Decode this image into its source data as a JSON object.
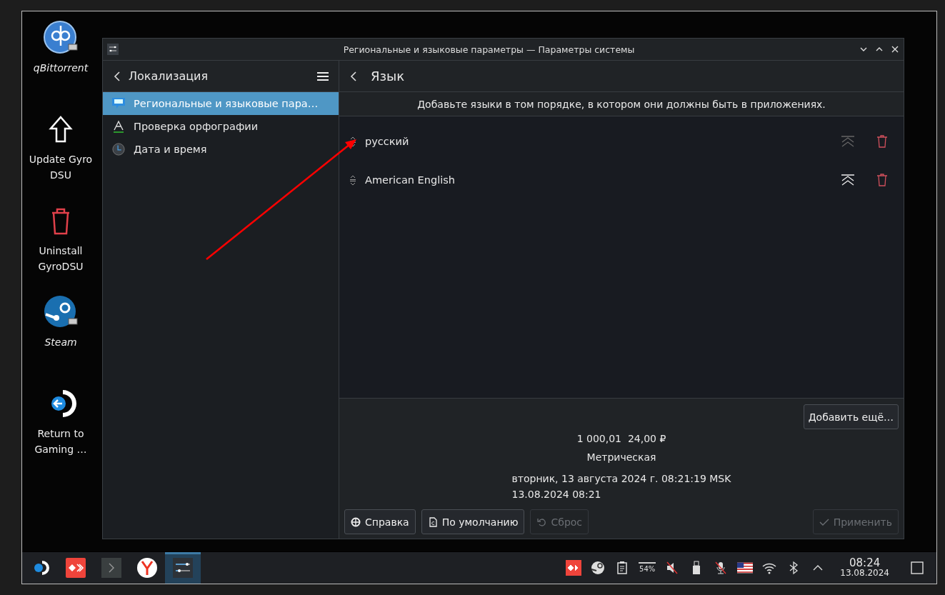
{
  "desktop_icons": [
    {
      "kind": "qbittorrent",
      "label": "qBittorrent",
      "link": true
    },
    {
      "kind": "update",
      "label": "Update Gyro DSU",
      "link": false
    },
    {
      "kind": "uninstall",
      "label": "Uninstall GyroDSU",
      "link": false
    },
    {
      "kind": "steam",
      "label": "Steam",
      "link": true
    },
    {
      "kind": "return",
      "label": "Return to Gaming …",
      "link": false
    }
  ],
  "window": {
    "title": "Региональные и языковые параметры — Параметры системы"
  },
  "sidebar": {
    "title": "Локализация",
    "items": [
      {
        "kind": "region",
        "label": "Региональные и языковые пара…",
        "selected": true
      },
      {
        "kind": "spelling",
        "label": "Проверка орфографии",
        "selected": false
      },
      {
        "kind": "clock",
        "label": "Дата и время",
        "selected": false
      }
    ]
  },
  "page": {
    "title": "Язык",
    "hint": "Добавьте языки в том порядке, в котором они должны быть в приложениях.",
    "languages": [
      {
        "name": "русский",
        "move_top_disabled": true
      },
      {
        "name": "American English",
        "move_top_disabled": false
      }
    ],
    "add_button": "Добавить ещё…",
    "preview": {
      "numbers": "1 000,01  24,00 ₽",
      "measurement": "Метрическая",
      "datetime_long": "вторник, 13 августа 2024 г. 08:21:19 MSK",
      "datetime_short": "13.08.2024 08:21"
    },
    "buttons": [
      {
        "kind": "help",
        "label": "Справка",
        "disabled": false
      },
      {
        "kind": "defaults",
        "label": "По умолчанию",
        "disabled": false
      },
      {
        "kind": "reset",
        "label": "Сброс",
        "disabled": true
      },
      {
        "kind": "apply",
        "label": "Применить",
        "disabled": true
      }
    ]
  },
  "taskbar": {
    "tasks": [
      {
        "kind": "launcher",
        "active": false
      },
      {
        "kind": "anydesk",
        "active": false
      },
      {
        "kind": "terminal",
        "active": false
      },
      {
        "kind": "browser",
        "active": false
      },
      {
        "kind": "settings",
        "active": true
      }
    ],
    "battery": "54%",
    "time": "08:24",
    "date": "13.08.2024"
  }
}
